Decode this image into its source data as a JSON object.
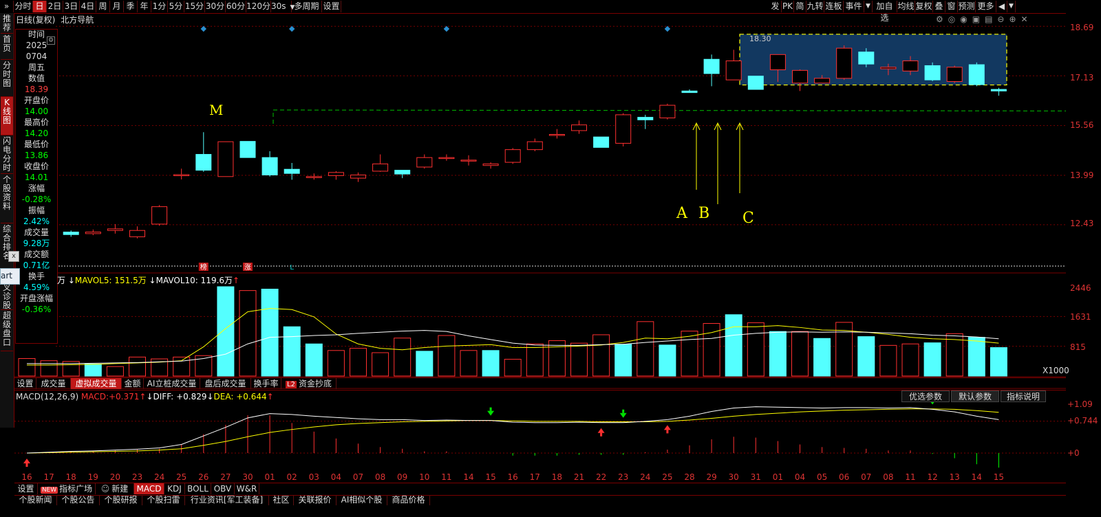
{
  "toolbar": {
    "left": [
      {
        "label": "分时",
        "active": false
      },
      {
        "label": "日",
        "active": true
      },
      {
        "label": "2日",
        "active": false
      },
      {
        "label": "3日",
        "active": false
      },
      {
        "label": "4日",
        "active": false
      },
      {
        "label": "周",
        "active": false
      },
      {
        "label": "月",
        "active": false
      },
      {
        "label": "季",
        "active": false
      },
      {
        "label": "年",
        "active": false
      },
      {
        "label": "1分",
        "active": false
      },
      {
        "label": "5分",
        "active": false
      },
      {
        "label": "15分",
        "active": false
      },
      {
        "label": "30分",
        "active": false
      },
      {
        "label": "60分",
        "active": false
      },
      {
        "label": "120分",
        "active": false
      },
      {
        "label": "30s",
        "active": false
      },
      {
        "label": "多周期",
        "active": false
      },
      {
        "label": "设置",
        "active": false
      }
    ],
    "right": [
      "发",
      "PK",
      "简",
      "九转",
      "连板",
      "事件",
      "加自选",
      "均线",
      "复权",
      "叠",
      "窗",
      "预测",
      "更多"
    ]
  },
  "sidebar": [
    "推荐",
    "首页",
    "分时图",
    "K线图",
    "闪电分时",
    "个股资料",
    "综合排名",
    "牛叉诊股",
    "超级盘口"
  ],
  "chart_title": {
    "period": "日线(复权)",
    "name": "北方导航"
  },
  "info_panel": {
    "rows": [
      {
        "label": "时间",
        "value": ""
      },
      {
        "label": "2025",
        "value": ""
      },
      {
        "label": "0704",
        "value": ""
      },
      {
        "label": "周五",
        "value": ""
      },
      {
        "label": "数值",
        "value": "18.39",
        "color": "#ff4040"
      },
      {
        "label": "开盘价",
        "value": "14.00",
        "color": "#00ff00"
      },
      {
        "label": "最高价",
        "value": "14.20",
        "color": "#00ff00"
      },
      {
        "label": "最低价",
        "value": "13.86",
        "color": "#00ff00"
      },
      {
        "label": "收盘价",
        "value": "14.01",
        "color": "#00ff00"
      },
      {
        "label": "涨幅",
        "value": "-0.28%",
        "color": "#00ff00"
      },
      {
        "label": "振幅",
        "value": "2.42%",
        "color": "#00ffff"
      },
      {
        "label": "成交量",
        "value": "9.28万",
        "color": "#00ffff"
      },
      {
        "label": "成交额",
        "value": "0.71亿",
        "color": "#00ffff"
      },
      {
        "label": "换手",
        "value": "4.59%",
        "color": "#00ffff"
      },
      {
        "label": "开盘涨幅",
        "value": "-0.36%",
        "color": "#00ff00"
      }
    ]
  },
  "annotations": {
    "M": "M",
    "A": "A",
    "B": "B",
    "C": "C",
    "box_high": "18.30"
  },
  "markers": [
    "榜",
    "涨",
    "L"
  ],
  "price_axis": [
    "18.69",
    "17.13",
    "15.56",
    "13.99",
    "12.43"
  ],
  "volume_axis": [
    "2446",
    "1631",
    "815",
    "X1000"
  ],
  "macd_axis": [
    "+1.09",
    "+0.744",
    "+0"
  ],
  "volume_header": {
    "prefix": "万",
    "mavol5_label": "MAVOL5:",
    "mavol5": "151.5万",
    "mavol10_label": "MAVOL10:",
    "mavol10": "119.6万"
  },
  "volume_tabs": [
    {
      "label": "设置",
      "active": false
    },
    {
      "label": "成交量",
      "active": false
    },
    {
      "label": "虚拟成交量",
      "active": true
    },
    {
      "label": "金额",
      "active": false
    },
    {
      "label": "AI立桩成交量",
      "active": false
    },
    {
      "label": "盘后成交量",
      "active": false
    },
    {
      "label": "换手率",
      "active": false
    },
    {
      "label": "资金抄底",
      "active": false,
      "badge": "L2"
    }
  ],
  "macd_header": {
    "name": "MACD(12,26,9)",
    "macd_label": "MACD:",
    "macd": "+0.371",
    "diff_label": "DIFF:",
    "diff": "+0.829",
    "dea_label": "DEA:",
    "dea": "+0.644"
  },
  "macd_buttons": [
    "优选参数",
    "默认参数",
    "指标说明"
  ],
  "date_axis": [
    "16",
    "17",
    "18",
    "19",
    "20",
    "23",
    "24",
    "25",
    "26",
    "27",
    "30",
    "01",
    "02",
    "03",
    "04",
    "07",
    "08",
    "09",
    "10",
    "11",
    "14",
    "15",
    "16",
    "17",
    "18",
    "21",
    "22",
    "23",
    "24",
    "25",
    "28",
    "29",
    "30",
    "31",
    "01",
    "04",
    "05",
    "06",
    "07",
    "08",
    "11",
    "12",
    "13",
    "14",
    "15"
  ],
  "indicator_tabs": [
    {
      "label": "设置"
    },
    {
      "label": "指标广场",
      "badge": "NEW"
    },
    {
      "label": "新建",
      "icon": "robot-icon"
    },
    {
      "label": "MACD",
      "active": true
    },
    {
      "label": "KDJ"
    },
    {
      "label": "BOLL"
    },
    {
      "label": "OBV"
    },
    {
      "label": "W&R"
    }
  ],
  "news_tabs": [
    "个股新闻",
    "个股公告",
    "个股研报",
    "个股扫雷",
    "行业资讯[军工装备]",
    "社区",
    "关联报价",
    "AI相似个股",
    "商品价格"
  ],
  "popup_label": "art",
  "colors": {
    "up": "#ff3030",
    "down": "#54ffff",
    "ma_white": "#ffffff",
    "ma_yellow": "#ffff00",
    "grid": "#7a0000",
    "dash_green": "#00c000",
    "box_fill": "#123860",
    "box_border": "#ffff00"
  },
  "chart_data": {
    "type": "candlestick",
    "dates": [
      "16",
      "17",
      "18",
      "19",
      "20",
      "23",
      "24",
      "25",
      "26",
      "27",
      "30",
      "01",
      "02",
      "03",
      "04",
      "07",
      "08",
      "09",
      "10",
      "11",
      "14",
      "15",
      "16",
      "17",
      "18",
      "21",
      "22",
      "23",
      "24",
      "25",
      "28",
      "29",
      "30",
      "31",
      "01",
      "04",
      "05",
      "06",
      "07",
      "08",
      "11",
      "12",
      "13",
      "14",
      "15"
    ],
    "ohlc": [
      [
        null,
        null,
        null,
        null
      ],
      [
        12.1,
        12.27,
        12.07,
        12.2
      ],
      [
        12.2,
        12.25,
        12.05,
        12.12
      ],
      [
        12.15,
        12.28,
        12.1,
        12.2
      ],
      [
        12.25,
        12.45,
        12.15,
        12.3
      ],
      [
        12.05,
        12.38,
        12.0,
        12.25
      ],
      [
        12.45,
        13.05,
        12.4,
        13.0
      ],
      [
        14.0,
        14.2,
        13.86,
        14.01
      ],
      [
        14.65,
        15.35,
        14.1,
        14.15
      ],
      [
        13.95,
        15.05,
        13.95,
        15.05
      ],
      [
        15.06,
        15.05,
        14.55,
        14.55
      ],
      [
        14.55,
        14.75,
        13.95,
        14.0
      ],
      [
        14.18,
        14.38,
        13.85,
        14.05
      ],
      [
        13.95,
        14.05,
        13.85,
        13.95
      ],
      [
        13.98,
        14.12,
        13.85,
        14.08
      ],
      [
        13.9,
        14.08,
        13.78,
        14.0
      ],
      [
        14.12,
        14.65,
        14.1,
        14.35
      ],
      [
        14.15,
        14.15,
        13.9,
        14.03
      ],
      [
        14.25,
        14.65,
        14.2,
        14.55
      ],
      [
        14.55,
        14.65,
        14.45,
        14.55
      ],
      [
        14.47,
        14.62,
        14.3,
        14.47
      ],
      [
        14.3,
        14.4,
        14.2,
        14.35
      ],
      [
        14.4,
        14.85,
        14.35,
        14.8
      ],
      [
        14.8,
        15.15,
        14.75,
        15.05
      ],
      [
        15.25,
        15.45,
        15.15,
        15.28
      ],
      [
        15.4,
        15.72,
        15.3,
        15.58
      ],
      [
        15.2,
        14.87,
        14.87,
        14.87
      ],
      [
        15.0,
        15.95,
        14.9,
        15.9
      ],
      [
        15.82,
        15.9,
        15.45,
        15.74
      ],
      [
        15.8,
        16.25,
        15.75,
        16.2
      ],
      [
        16.65,
        16.7,
        16.6,
        16.6
      ],
      [
        17.65,
        17.8,
        16.8,
        17.2
      ],
      [
        17.0,
        17.95,
        17.0,
        17.6
      ],
      [
        17.12,
        17.05,
        16.7,
        16.7
      ],
      [
        17.32,
        17.8,
        16.94,
        17.8
      ],
      [
        16.9,
        17.33,
        16.65,
        17.3
      ],
      [
        16.9,
        17.15,
        16.9,
        17.05
      ],
      [
        17.05,
        18.09,
        17.0,
        18.0
      ],
      [
        17.88,
        18.0,
        17.4,
        17.5
      ],
      [
        17.35,
        17.51,
        17.15,
        17.4
      ],
      [
        17.28,
        17.75,
        17.15,
        17.6
      ],
      [
        17.45,
        17.55,
        16.96,
        17.0
      ],
      [
        16.95,
        17.45,
        16.9,
        17.4
      ],
      [
        17.48,
        17.55,
        16.8,
        16.85
      ],
      [
        16.7,
        16.75,
        16.5,
        16.65
      ]
    ],
    "volume": [
      480,
      420,
      400,
      330,
      260,
      520,
      470,
      520,
      560,
      2446,
      2340,
      2380,
      1350,
      880,
      700,
      760,
      640,
      1040,
      680,
      1110,
      700,
      700,
      460,
      880,
      970,
      900,
      1130,
      870,
      1490,
      850,
      1230,
      1440,
      1680,
      1460,
      1220,
      1220,
      1030,
      1470,
      1080,
      840,
      880,
      910,
      1160,
      1060,
      780
    ],
    "volume_up": [
      true,
      true,
      true,
      false,
      true,
      true,
      true,
      true,
      true,
      false,
      true,
      false,
      false,
      false,
      true,
      true,
      true,
      true,
      false,
      true,
      true,
      false,
      true,
      true,
      true,
      true,
      true,
      false,
      true,
      false,
      true,
      true,
      false,
      true,
      false,
      true,
      false,
      true,
      false,
      true,
      true,
      false,
      true,
      false,
      false
    ],
    "mavol5": [
      300,
      300,
      310,
      320,
      340,
      360,
      380,
      420,
      800,
      1300,
      1760,
      1850,
      1820,
      1620,
      1150,
      880,
      760,
      720,
      780,
      820,
      840,
      860,
      780,
      780,
      800,
      820,
      850,
      920,
      1040,
      1020,
      1090,
      1190,
      1350,
      1350,
      1380,
      1330,
      1260,
      1250,
      1200,
      1140,
      1060,
      1020,
      1000,
      960,
      900
    ],
    "mavol10": [
      340,
      340,
      340,
      350,
      360,
      370,
      390,
      410,
      480,
      600,
      880,
      1060,
      1080,
      1110,
      1130,
      1170,
      1200,
      1230,
      1250,
      1220,
      1100,
      1000,
      900,
      850,
      840,
      840,
      860,
      870,
      920,
      960,
      1000,
      1030,
      1120,
      1170,
      1200,
      1210,
      1200,
      1210,
      1200,
      1180,
      1160,
      1120,
      1100,
      1070,
      1020
    ],
    "diff": [
      0.0,
      0.02,
      0.04,
      0.05,
      0.07,
      0.09,
      0.12,
      0.2,
      0.4,
      0.6,
      0.82,
      0.92,
      0.9,
      0.86,
      0.83,
      0.8,
      0.78,
      0.78,
      0.76,
      0.77,
      0.76,
      0.76,
      0.72,
      0.71,
      0.71,
      0.72,
      0.71,
      0.71,
      0.74,
      0.78,
      0.86,
      0.97,
      1.05,
      1.08,
      1.07,
      1.06,
      1.05,
      1.06,
      1.06,
      1.05,
      1.06,
      1.02,
      0.96,
      0.86,
      0.78
    ],
    "dea": [
      0.0,
      0.01,
      0.02,
      0.03,
      0.04,
      0.05,
      0.07,
      0.1,
      0.18,
      0.27,
      0.38,
      0.48,
      0.55,
      0.61,
      0.66,
      0.69,
      0.71,
      0.73,
      0.74,
      0.75,
      0.76,
      0.76,
      0.75,
      0.74,
      0.74,
      0.74,
      0.73,
      0.73,
      0.73,
      0.74,
      0.77,
      0.81,
      0.86,
      0.9,
      0.93,
      0.96,
      0.98,
      1.0,
      1.01,
      1.02,
      1.03,
      1.03,
      1.02,
      0.99,
      0.95
    ],
    "macd": [
      0.0,
      0.02,
      0.04,
      0.05,
      0.06,
      0.08,
      0.1,
      0.2,
      0.44,
      0.66,
      0.88,
      0.88,
      0.7,
      0.5,
      0.34,
      0.22,
      0.14,
      0.1,
      0.04,
      0.04,
      0.0,
      0.0,
      -0.06,
      -0.06,
      -0.06,
      -0.04,
      -0.04,
      -0.04,
      0.02,
      0.08,
      0.18,
      0.32,
      0.38,
      0.36,
      0.28,
      0.2,
      0.14,
      0.12,
      0.1,
      0.06,
      0.06,
      -0.02,
      -0.12,
      -0.26,
      -0.34
    ],
    "price_range": [
      11.3,
      19.0
    ]
  }
}
